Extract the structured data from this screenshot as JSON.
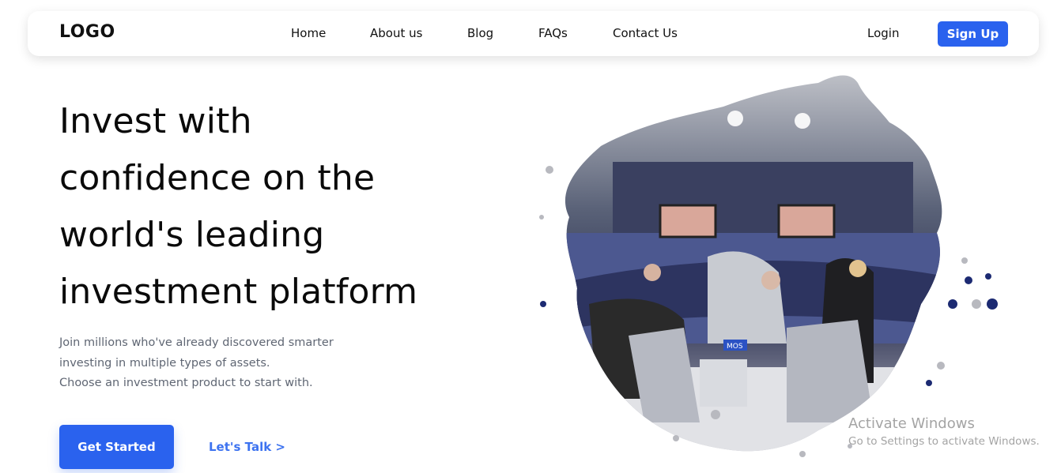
{
  "header": {
    "logo": "LOGO",
    "nav": [
      {
        "label": "Home"
      },
      {
        "label": "About us"
      },
      {
        "label": "Blog"
      },
      {
        "label": "FAQs"
      },
      {
        "label": "Contact Us"
      }
    ],
    "login_label": "Login",
    "signup_label": "Sign Up"
  },
  "hero": {
    "title_lines": [
      "Invest with",
      "confidence on the",
      "world's leading",
      "investment platform"
    ],
    "subtitle_lines": [
      "Join millions who've already discovered smarter",
      "investing in multiple types of assets.",
      "Choose an investment product to start with."
    ],
    "primary_cta": "Get Started",
    "secondary_cta": "Let's Talk >"
  },
  "image": {
    "description": "panel-discussion-photo",
    "screen_label": "MOS"
  },
  "watermark": {
    "title": "Activate Windows",
    "subtitle": "Go to Settings to activate Windows."
  },
  "colors": {
    "accent": "#2a62ee",
    "link": "#3d73f0",
    "text": "#0a0a0a",
    "muted": "#5f6673"
  }
}
